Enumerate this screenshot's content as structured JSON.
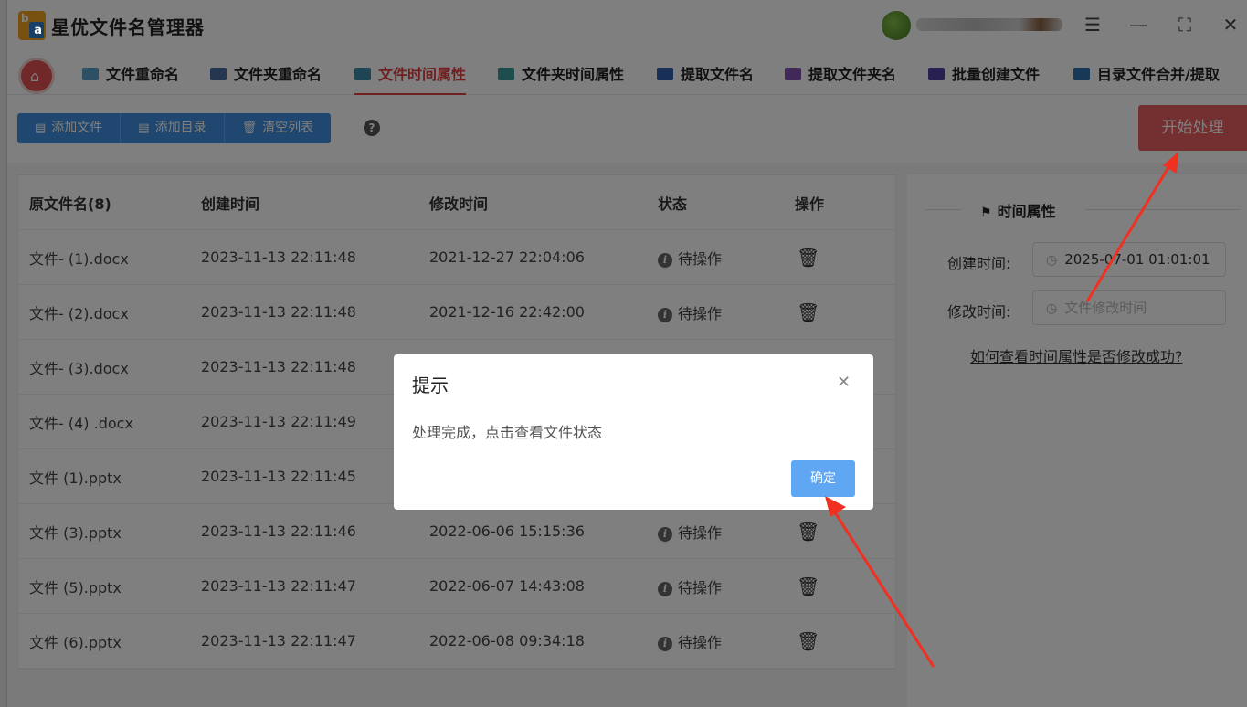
{
  "app": {
    "title": "星优文件名管理器"
  },
  "tabs": [
    {
      "label": "文件重命名",
      "icon": "#5aa0c8"
    },
    {
      "label": "文件夹重命名",
      "icon": "#4a6fa0"
    },
    {
      "label": "文件时间属性",
      "icon": "#3a8aa8",
      "active": true
    },
    {
      "label": "文件夹时间属性",
      "icon": "#3a9a9a"
    },
    {
      "label": "提取文件名",
      "icon": "#3060b0"
    },
    {
      "label": "提取文件夹名",
      "icon": "#8050b0"
    },
    {
      "label": "批量创建文件",
      "icon": "#5040a0"
    },
    {
      "label": "目录文件合并/提取",
      "icon": "#3070b0"
    }
  ],
  "toolbar": {
    "add_file": "添加文件",
    "add_dir": "添加目录",
    "clear_list": "清空列表",
    "help": "?",
    "start": "开始处理"
  },
  "table": {
    "headers": {
      "name": "原文件名(8)",
      "created": "创建时间",
      "modified": "修改时间",
      "status": "状态",
      "action": "操作"
    },
    "rows": [
      {
        "name": "文件- (1).docx",
        "created": "2023-11-13 22:11:48",
        "modified": "2021-12-27 22:04:06",
        "status": "待操作"
      },
      {
        "name": "文件- (2).docx",
        "created": "2023-11-13 22:11:48",
        "modified": "2021-12-16 22:42:00",
        "status": "待操作"
      },
      {
        "name": "文件- (3).docx",
        "created": "2023-11-13 22:11:48",
        "modified": "",
        "status": ""
      },
      {
        "name": "文件- (4) .docx",
        "created": "2023-11-13 22:11:49",
        "modified": "",
        "status": ""
      },
      {
        "name": "文件 (1).pptx",
        "created": "2023-11-13 22:11:45",
        "modified": "",
        "status": ""
      },
      {
        "name": "文件 (3).pptx",
        "created": "2023-11-13 22:11:46",
        "modified": "2022-06-06 15:15:36",
        "status": "待操作"
      },
      {
        "name": "文件 (5).pptx",
        "created": "2023-11-13 22:11:47",
        "modified": "2022-06-07 14:43:08",
        "status": "待操作"
      },
      {
        "name": "文件 (6).pptx",
        "created": "2023-11-13 22:11:47",
        "modified": "2022-06-08 09:34:18",
        "status": "待操作"
      }
    ]
  },
  "panel": {
    "title": "时间属性",
    "created_label": "创建时间:",
    "created_value": "2025-07-01 01:01:01",
    "modified_label": "修改时间:",
    "modified_placeholder": "文件修改时间",
    "link": "如何查看时间属性是否修改成功?"
  },
  "dialog": {
    "title": "提示",
    "message": "处理完成，点击查看文件状态",
    "ok": "确定"
  },
  "colors": {
    "accent_red": "#e86060",
    "primary_blue": "#3f8fdf",
    "annotation_arrow": "#f03020"
  }
}
